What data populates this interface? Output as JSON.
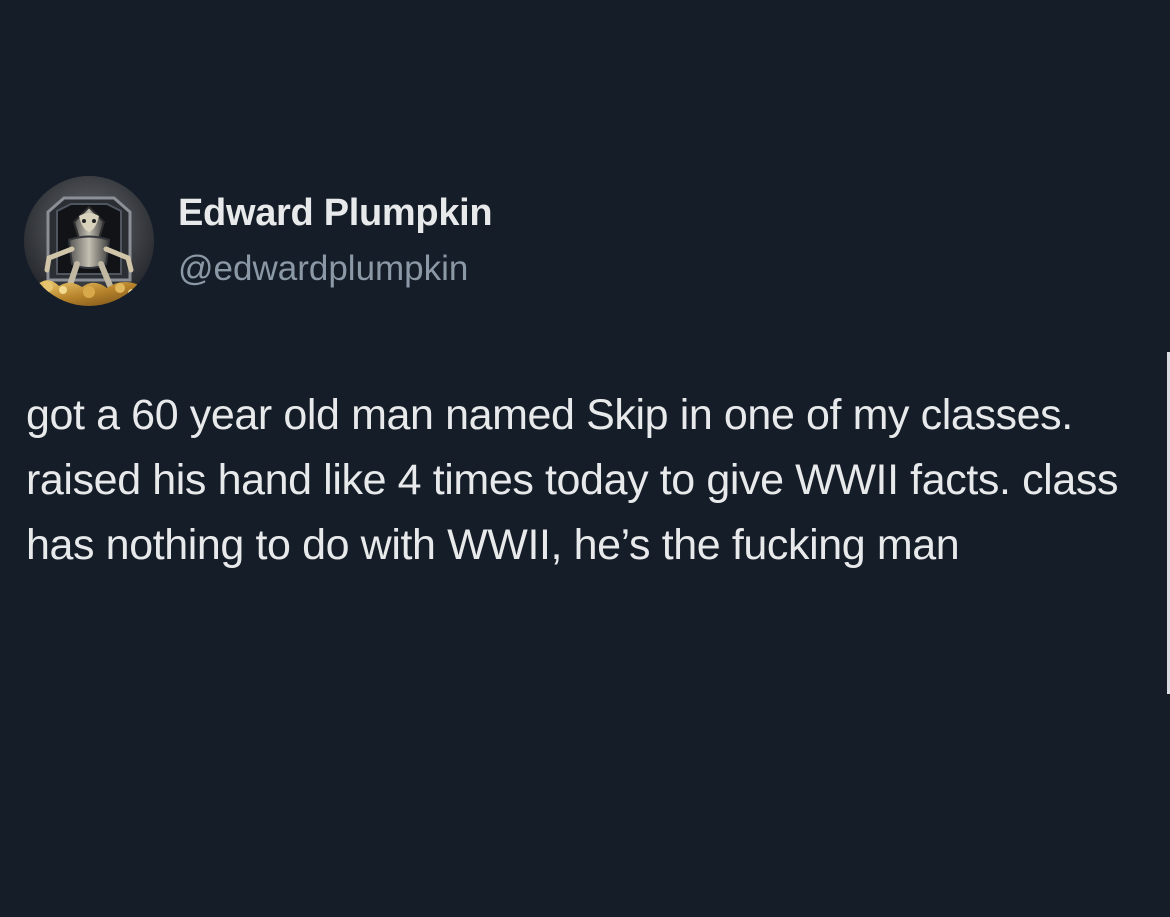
{
  "tweet": {
    "author": {
      "display_name": "Edward Plumpkin",
      "handle": "@edwardplumpkin",
      "avatar_icon": "robot-general-on-throne-avatar"
    },
    "text": "got a 60 year old man named Skip in one of my classes. raised his hand like 4 times today to give WWII facts. class has nothing to do with WWII, he’s the fucking man"
  },
  "colors": {
    "background": "#151d28",
    "primary_text": "#e7e9ea",
    "secondary_text": "#8b98a5"
  }
}
